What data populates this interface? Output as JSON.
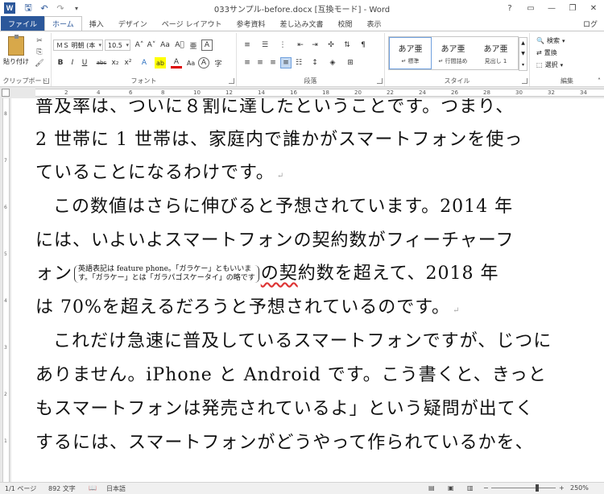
{
  "window": {
    "title": "033サンプル-before.docx [互換モード] - Word",
    "controls": [
      "?",
      "▭",
      "—",
      "❐",
      "✕"
    ],
    "login": "ログ"
  },
  "qat": {
    "save_icon": "save-icon",
    "undo_icon": "undo-icon",
    "redo_icon": "redo-icon"
  },
  "tabs": [
    {
      "label": "ファイル"
    },
    {
      "label": "ホーム"
    },
    {
      "label": "挿入"
    },
    {
      "label": "デザイン"
    },
    {
      "label": "ページ レイアウト"
    },
    {
      "label": "参考資料"
    },
    {
      "label": "差し込み文書"
    },
    {
      "label": "校閲"
    },
    {
      "label": "表示"
    }
  ],
  "ribbon": {
    "clipboard": {
      "paste_label": "貼り付け",
      "group_label": "クリップボード"
    },
    "font": {
      "font_name": "ＭＳ 明朝 (本",
      "font_size": "10.5",
      "group_label": "フォント",
      "row1": [
        "A˄",
        "A˅",
        "Aa",
        "A⃠",
        "亜",
        "A"
      ],
      "row2": [
        "B",
        "I",
        "U",
        "abc",
        "x₂",
        "x²",
        "A",
        "ab",
        "A",
        "Aa",
        "A",
        "字"
      ]
    },
    "paragraph": {
      "group_label": "段落"
    },
    "styles": {
      "group_label": "スタイル",
      "items": [
        {
          "sample": "あア亜",
          "name": "↵ 標準"
        },
        {
          "sample": "あア亜",
          "name": "↵ 行間詰め"
        },
        {
          "sample": "あア亜",
          "name": "見出し 1"
        }
      ]
    },
    "editing": {
      "group_label": "編集",
      "find": "検索",
      "replace": "置換",
      "select": "選択"
    }
  },
  "ruler": {
    "numbers": [
      "2",
      "4",
      "6",
      "8",
      "10",
      "12",
      "14",
      "16",
      "18",
      "20",
      "22",
      "24",
      "26",
      "28",
      "30",
      "32",
      "34"
    ]
  },
  "vruler": {
    "numbers": [
      "8",
      "7",
      "6",
      "5",
      "4",
      "3",
      "2",
      "1"
    ]
  },
  "document": {
    "lines": [
      {
        "text": "普及率は、ついに８割に達したということです。つまり、"
      },
      {
        "text": "2 世帯に 1 世帯は、家庭内で誰かがスマートフォンを使っ"
      },
      {
        "text": "ていることになるわけです。"
      },
      {
        "text": "この数値はさらに伸びると予想されています。2014 年"
      },
      {
        "text": "には、いよいよスマートフォンの契約数がフィーチャーフ"
      },
      {
        "before": "ォン",
        "ruby1": "英語表記は feature phone。「ガラケー」ともいいま",
        "ruby2": "す。「ガラケー」とは「ガラパゴスケータイ」の略です",
        "after_wavy": "の契",
        "after": "約数を超えて、2018 年"
      },
      {
        "text": "は 70%を超えるだろうと予想されているのです。"
      },
      {
        "text": "これだけ急速に普及しているスマートフォンですが、じつに"
      },
      {
        "text": "ありません。iPhone と Android です。こう書くと、きっと"
      },
      {
        "text": "もスマートフォンは発売されているよ」という疑問が出てく"
      },
      {
        "text": "するには、スマートフォンがどうやって作られているかを、"
      }
    ]
  },
  "status": {
    "page": "1/1 ページ",
    "words": "892 文字",
    "language": "日本語",
    "zoom": "250%",
    "zoom_level": 0.72
  }
}
